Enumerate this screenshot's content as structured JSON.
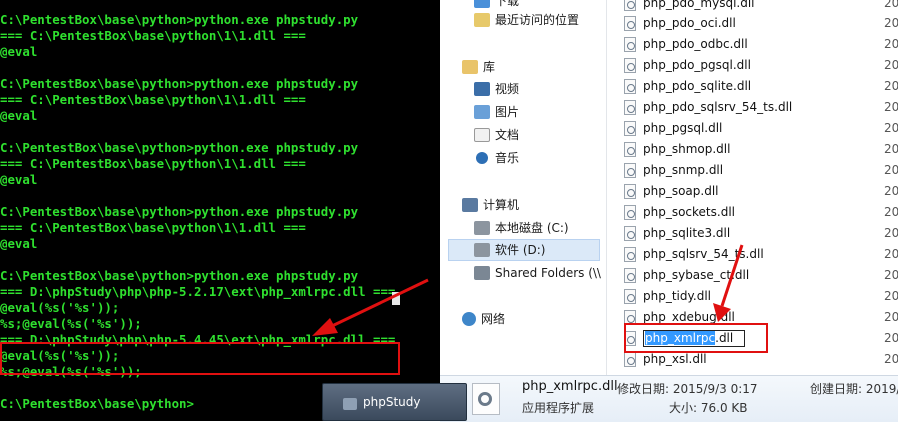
{
  "console": {
    "lines": [
      "C:\\PentestBox\\base\\python>python.exe phpstudy.py",
      "=== C:\\PentestBox\\base\\python\\1\\1.dll ===",
      "@eval",
      "",
      "C:\\PentestBox\\base\\python>python.exe phpstudy.py",
      "=== C:\\PentestBox\\base\\python\\1\\1.dll ===",
      "@eval",
      "",
      "C:\\PentestBox\\base\\python>python.exe phpstudy.py",
      "=== C:\\PentestBox\\base\\python\\1\\1.dll ===",
      "@eval",
      "",
      "C:\\PentestBox\\base\\python>python.exe phpstudy.py",
      "=== C:\\PentestBox\\base\\python\\1\\1.dll ===",
      "@eval",
      "",
      "C:\\PentestBox\\base\\python>python.exe phpstudy.py",
      "=== D:\\phpStudy\\php\\php-5.2.17\\ext\\php_xmlrpc.dll ===",
      "@eval(%s('%s'));",
      "%s;@eval(%s('%s'));",
      "=== D:\\phpStudy\\php\\php-5.4.45\\ext\\php_xmlrpc.dll ===",
      "@eval(%s('%s'));",
      "%s;@eval(%s('%s'));",
      "",
      "C:\\PentestBox\\base\\python>"
    ]
  },
  "nav": {
    "top_partial": "下载",
    "recent": "最近访问的位置",
    "library": "库",
    "videos": "视频",
    "pictures": "图片",
    "documents": "文档",
    "music": "音乐",
    "computer": "计算机",
    "local_disk": "本地磁盘 (C:)",
    "software_disk": "软件 (D:)",
    "shared_folders": "Shared Folders (\\\\",
    "network": "网络"
  },
  "files": [
    "php_pdo_mysql.dll",
    "php_pdo_oci.dll",
    "php_pdo_odbc.dll",
    "php_pdo_pgsql.dll",
    "php_pdo_sqlite.dll",
    "php_pdo_sqlsrv_54_ts.dll",
    "php_pgsql.dll",
    "php_shmop.dll",
    "php_snmp.dll",
    "php_soap.dll",
    "php_sockets.dll",
    "php_sqlite3.dll",
    "php_sqlsrv_54_ts.dll",
    "php_sybase_ct.dll",
    "php_tidy.dll",
    "php_xdebug.dll"
  ],
  "rename": {
    "selected": "php_xmlrpc",
    "suffix": ".dll"
  },
  "last_file": "php_xsl.dll",
  "date_prefix": "20",
  "status": {
    "file_name": "php_xmlrpc.dll",
    "modified": "修改日期: 2015/9/3 0:17",
    "created": "创建日期: 2019/",
    "type": "应用程序扩展",
    "size": "大小: 76.0 KB"
  },
  "taskbar": {
    "label": "phpStudy"
  },
  "colors": {
    "console_text": "#2fe02f",
    "highlight": "#e01010",
    "selection": "#3399ff"
  }
}
